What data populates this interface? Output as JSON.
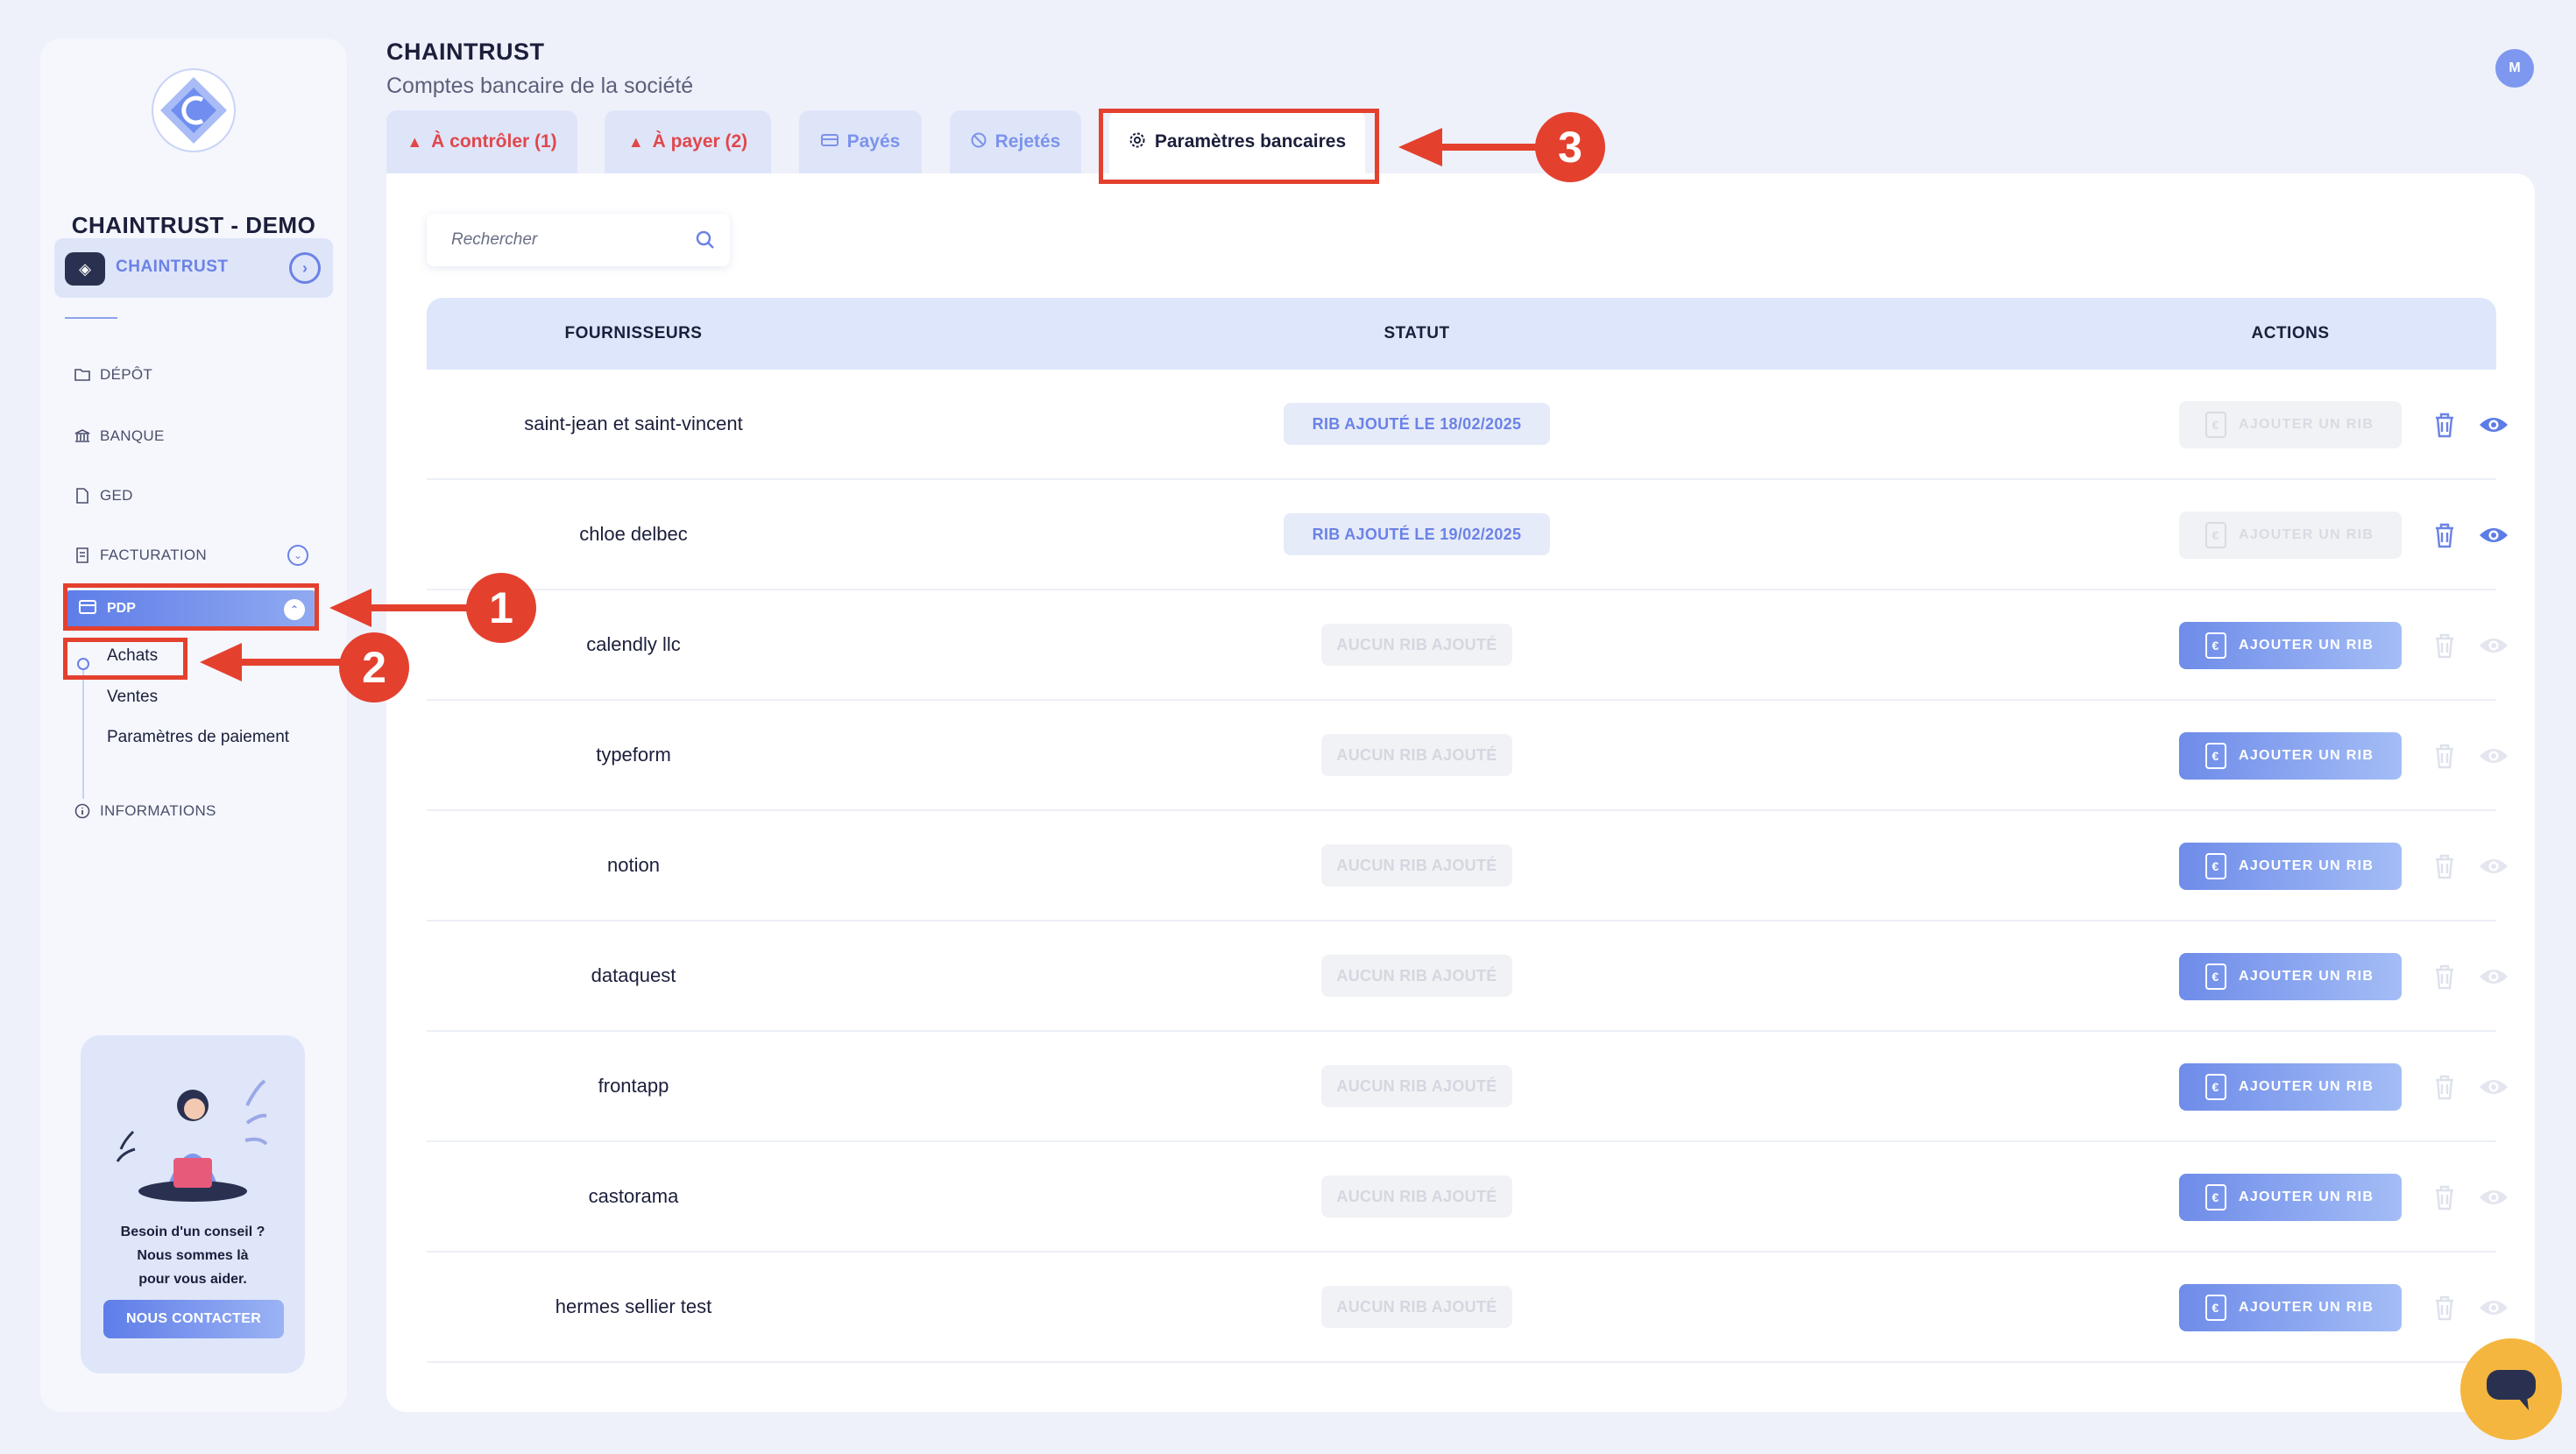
{
  "sidebar": {
    "org_name": "CHAINTRUST - DEMO",
    "company_label": "CHAINTRUST",
    "nav": {
      "depot": "DÉPÔT",
      "banque": "BANQUE",
      "ged": "GED",
      "facturation": "FACTURATION",
      "pdp": "PDP",
      "informations": "INFORMATIONS"
    },
    "pdp_sub": [
      "Achats",
      "Ventes",
      "Paramètres de paiement"
    ],
    "help": {
      "line1": "Besoin d'un conseil ?",
      "line2": "Nous sommes là",
      "line3": "pour vous aider.",
      "button": "NOUS CONTACTER"
    }
  },
  "header": {
    "title": "CHAINTRUST",
    "subtitle": "Comptes bancaire de la société",
    "avatar": "M"
  },
  "tabs": [
    {
      "label": "À contrôler (1)",
      "icon": "warning-icon",
      "color": "#e0474c"
    },
    {
      "label": "À payer (2)",
      "icon": "warning-icon",
      "color": "#e0474c"
    },
    {
      "label": "Payés",
      "icon": "payment-icon",
      "color": "#7b93ea"
    },
    {
      "label": "Rejetés",
      "icon": "block-icon",
      "color": "#7b93ea"
    },
    {
      "label": "Paramètres bancaires",
      "icon": "gear-icon",
      "active": true
    }
  ],
  "search": {
    "placeholder": "Rechercher"
  },
  "table": {
    "headers": {
      "suppliers": "FOURNISSEURS",
      "status": "STATUT",
      "actions": "ACTIONS"
    },
    "add_label": "AJOUTER UN RIB",
    "rows": [
      {
        "name": "saint-jean et saint-vincent",
        "status": "RIB AJOUTÉ LE 18/02/2025",
        "has_rib": true
      },
      {
        "name": "chloe delbec",
        "status": "RIB AJOUTÉ LE 19/02/2025",
        "has_rib": true
      },
      {
        "name": "calendly llc",
        "status": "AUCUN RIB AJOUTÉ",
        "has_rib": false
      },
      {
        "name": "typeform",
        "status": "AUCUN RIB AJOUTÉ",
        "has_rib": false
      },
      {
        "name": "notion",
        "status": "AUCUN RIB AJOUTÉ",
        "has_rib": false
      },
      {
        "name": "dataquest",
        "status": "AUCUN RIB AJOUTÉ",
        "has_rib": false
      },
      {
        "name": "frontapp",
        "status": "AUCUN RIB AJOUTÉ",
        "has_rib": false
      },
      {
        "name": "castorama",
        "status": "AUCUN RIB AJOUTÉ",
        "has_rib": false
      },
      {
        "name": "hermes sellier test",
        "status": "AUCUN RIB AJOUTÉ",
        "has_rib": false
      }
    ]
  },
  "annotations": [
    "1",
    "2",
    "3"
  ],
  "colors": {
    "accent": "#6b82e6",
    "annotation": "#e4402e",
    "chat": "#f4b63e"
  }
}
